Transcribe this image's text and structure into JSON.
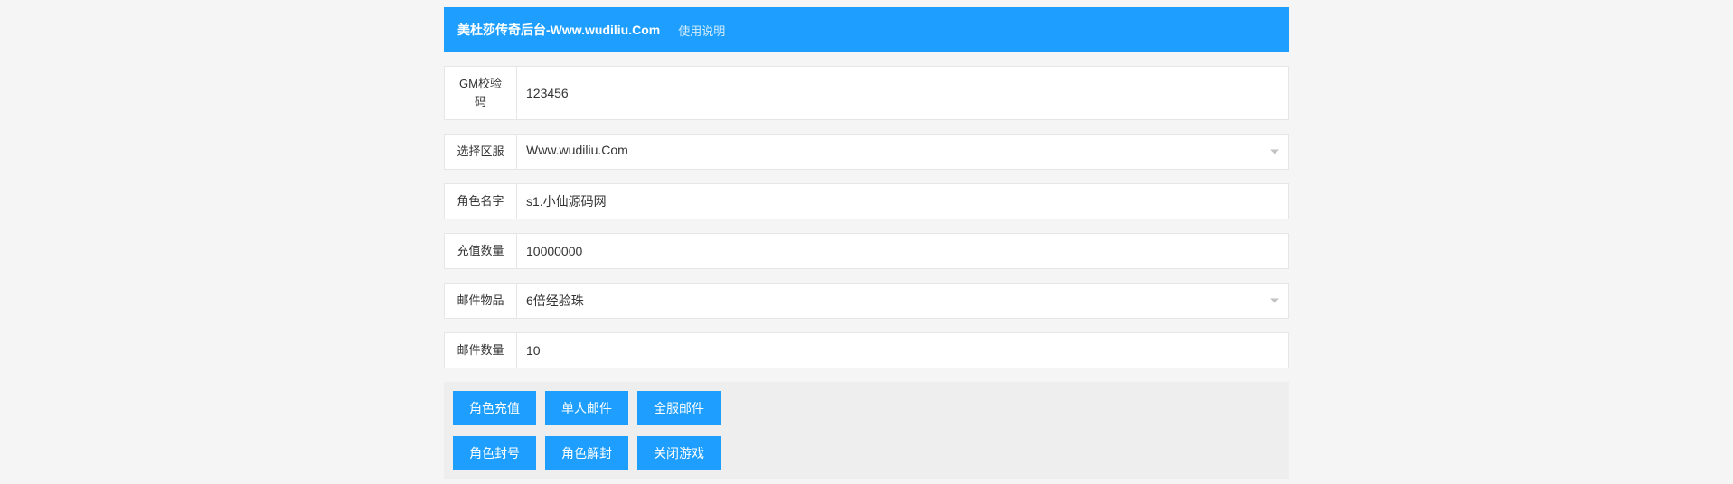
{
  "header": {
    "title": "美杜莎传奇后台-Www.wudiliu.Com",
    "usage_link": "使用说明"
  },
  "form": {
    "gm_code": {
      "label": "GM校验码",
      "value": "123456"
    },
    "server": {
      "label": "选择区服",
      "value": "Www.wudiliu.Com"
    },
    "role_name": {
      "label": "角色名字",
      "value": "s1.小仙源码网"
    },
    "recharge_amount": {
      "label": "充值数量",
      "value": "10000000"
    },
    "mail_item": {
      "label": "邮件物品",
      "value": "6倍经验珠"
    },
    "mail_count": {
      "label": "邮件数量",
      "value": "10"
    }
  },
  "buttons": {
    "row1": {
      "role_recharge": "角色充值",
      "single_mail": "单人邮件",
      "all_server_mail": "全服邮件"
    },
    "row2": {
      "role_ban": "角色封号",
      "role_unban": "角色解封",
      "close_game": "关闭游戏"
    }
  }
}
